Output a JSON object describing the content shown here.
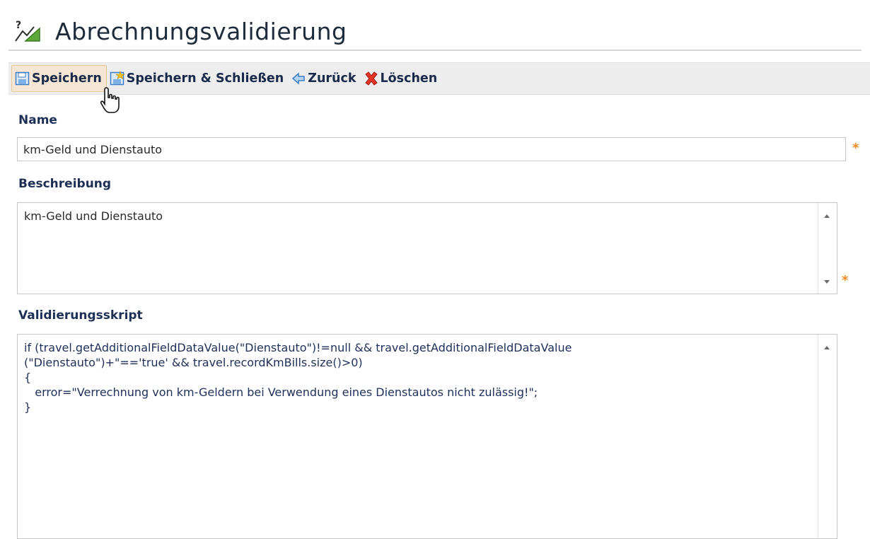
{
  "page": {
    "title": "Abrechnungsvalidierung"
  },
  "toolbar": {
    "save_label": "Speichern",
    "save_close_label": "Speichern & Schließen",
    "back_label": "Zurück",
    "delete_label": "Löschen"
  },
  "form": {
    "name_label": "Name",
    "name_value": "km-Geld und Dienstauto",
    "description_label": "Beschreibung",
    "description_value": "km-Geld und Dienstauto",
    "script_label": "Validierungsskript",
    "script_value": "if (travel.getAdditionalFieldDataValue(\"Dienstauto\")!=null && travel.getAdditionalFieldDataValue\n(\"Dienstauto\")+\"=='true' && travel.recordKmBills.size()>0)\n{\n   error=\"Verrechnung von km-Geldern bei Verwendung eines Dienstautos nicht zulässig!\";\n}",
    "required_marker": "*"
  },
  "colors": {
    "label": "#1e2f55",
    "required": "#f08a1e",
    "toolbar_bg": "#ededed",
    "active_button_bg": "#f6e7d4"
  },
  "icons": {
    "app": "chart-help-icon",
    "save": "floppy-disk-icon",
    "save_close": "floppy-disk-star-icon",
    "back": "back-arrow-icon",
    "delete": "red-x-icon",
    "pointer": "hand-cursor-icon"
  }
}
